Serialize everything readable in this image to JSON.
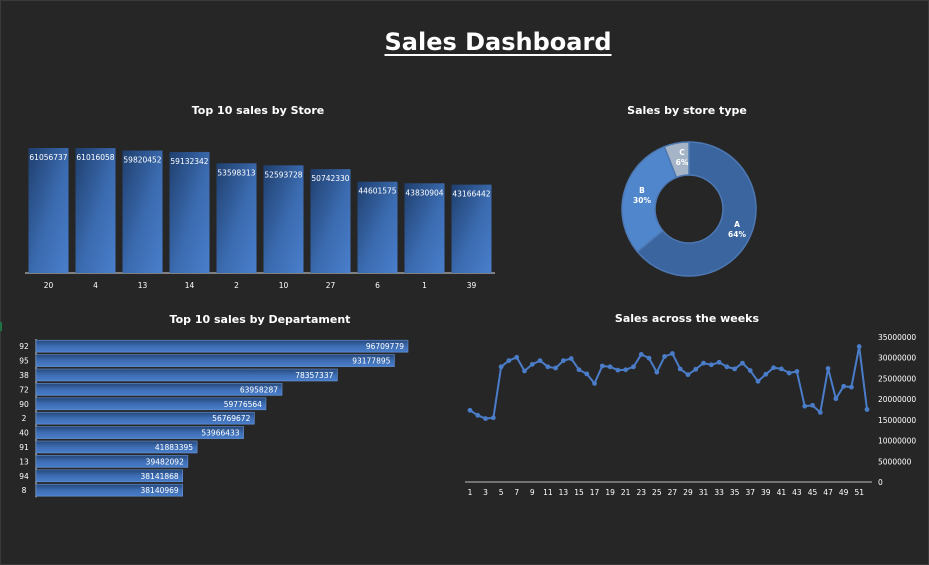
{
  "dashboard": {
    "title": "Sales Dashboard"
  },
  "colors": {
    "background": "#262626",
    "bar": "#4472c4",
    "bar_dark": "#2f5597",
    "line": "#4a7cc8",
    "donut_a": "#3a659f",
    "donut_b": "#5086cc",
    "donut_c": "#a6b4c8"
  },
  "chart_data": [
    {
      "id": "store",
      "type": "bar",
      "title": "Top 10 sales by Store",
      "categories": [
        "20",
        "4",
        "13",
        "14",
        "2",
        "10",
        "27",
        "6",
        "1",
        "39"
      ],
      "values": [
        61056737,
        61016058,
        59820452,
        59132342,
        53598313,
        52593728,
        50742330,
        44601575,
        43830904,
        43166442
      ],
      "data_labels": [
        "61056737",
        "61016058",
        "59820452",
        "59132342",
        "53598313",
        "52593728",
        "50742330",
        "44601575",
        "43830904",
        "43166442"
      ],
      "ylim": [
        0,
        61056737
      ],
      "grid": false,
      "legend": "none"
    },
    {
      "id": "storetype",
      "type": "pie",
      "donut": true,
      "title": "Sales by store type",
      "categories": [
        "A",
        "B",
        "C"
      ],
      "values": [
        64,
        30,
        6
      ],
      "data_labels": [
        "64%",
        "30%",
        "6%"
      ],
      "legend": "none"
    },
    {
      "id": "dept",
      "type": "bar",
      "orientation": "horizontal",
      "title": "Top 10 sales by Departament",
      "categories": [
        "92",
        "95",
        "38",
        "72",
        "90",
        "2",
        "40",
        "91",
        "13",
        "94",
        "8"
      ],
      "values": [
        96709779,
        93177895,
        78357337,
        63958287,
        59776564,
        56769672,
        53966433,
        41883395,
        39482092,
        38141868,
        38140969
      ],
      "data_labels": [
        "96709779",
        "93177895",
        "78357337",
        "63958287",
        "59776564",
        "56769672",
        "53966433",
        "41883395",
        "39482092",
        "38141868",
        "38140969"
      ],
      "grid": false,
      "legend": "none"
    },
    {
      "id": "weeks",
      "type": "line",
      "title": "Sales across the weeks",
      "x": [
        1,
        2,
        3,
        4,
        5,
        6,
        7,
        8,
        9,
        10,
        11,
        12,
        13,
        14,
        15,
        16,
        17,
        18,
        19,
        20,
        21,
        22,
        23,
        24,
        25,
        26,
        27,
        28,
        29,
        30,
        31,
        32,
        33,
        34,
        35,
        36,
        37,
        38,
        39,
        40,
        41,
        42,
        43,
        44,
        45,
        46,
        47,
        48,
        49,
        50,
        51,
        52
      ],
      "x_tick_labels": [
        "1",
        "3",
        "5",
        "7",
        "9",
        "11",
        "13",
        "15",
        "17",
        "19",
        "21",
        "23",
        "25",
        "27",
        "29",
        "31",
        "33",
        "35",
        "37",
        "39",
        "41",
        "43",
        "45",
        "47",
        "49",
        "51"
      ],
      "values": [
        17300000,
        16100000,
        15300000,
        15500000,
        27800000,
        29300000,
        30100000,
        26800000,
        28400000,
        29300000,
        27800000,
        27500000,
        29300000,
        29800000,
        27100000,
        26100000,
        23800000,
        28000000,
        27800000,
        27000000,
        27100000,
        27800000,
        30800000,
        29900000,
        26500000,
        30300000,
        31000000,
        27300000,
        25900000,
        27200000,
        28700000,
        28300000,
        28900000,
        27800000,
        27300000,
        28700000,
        26900000,
        24300000,
        26000000,
        27600000,
        27300000,
        26300000,
        26700000,
        18300000,
        18500000,
        16800000,
        27400000,
        20100000,
        23100000,
        22900000,
        32700000,
        17500000
      ],
      "y_ticks": [
        "0",
        "5000000",
        "10000000",
        "15000000",
        "20000000",
        "25000000",
        "30000000",
        "35000000"
      ],
      "ylim": [
        0,
        35000000
      ],
      "y_axis_side": "right",
      "grid": false,
      "legend": "none"
    }
  ]
}
